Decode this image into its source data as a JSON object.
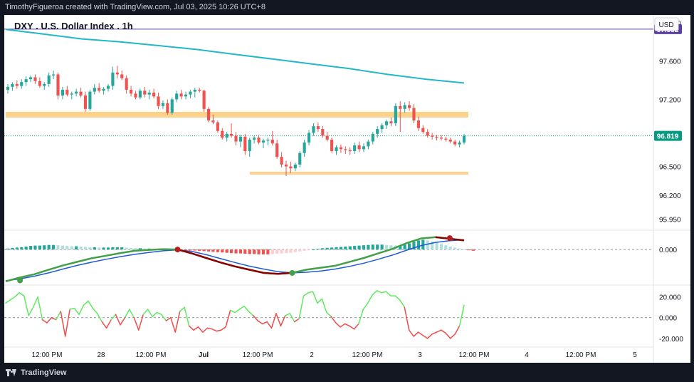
{
  "header": {
    "credit": "TimothyFigueroa created with TradingView.com, Jul 03, 2025 10:26 UTC+8"
  },
  "footer": {
    "brand": "TradingView"
  },
  "chart_data": {
    "type": "candlestick",
    "title": "DXY . U.S. Dollar Index . 1h",
    "currency_label": "USD",
    "price_axis": {
      "ylim": [
        95.85,
        98.08
      ],
      "ticks": [
        "98.000",
        "97.600",
        "97.200",
        "96.500",
        "96.200",
        "95.950"
      ],
      "tick_values": [
        98.0,
        97.6,
        97.2,
        96.5,
        96.2,
        95.95
      ]
    },
    "markers": [
      {
        "label": "97.932",
        "value": 97.932,
        "color": "#5b3fa3"
      },
      {
        "label": "96.819",
        "value": 96.819,
        "color": "#089981"
      }
    ],
    "x_axis": {
      "ticks": [
        "12:00 PM",
        "28",
        "12:00 PM",
        "Jul",
        "12:00 PM",
        "2",
        "12:00 PM",
        "3",
        "12:00 PM",
        "4",
        "12:00 PM",
        "5"
      ],
      "bold_ticks": [
        "Jul"
      ]
    },
    "moving_average": {
      "color": "#22b8c9",
      "values": [
        97.93,
        97.88,
        97.83,
        97.8,
        97.76,
        97.72,
        97.67,
        97.62,
        97.57,
        97.52,
        97.46,
        97.41,
        97.37
      ]
    },
    "zones": [
      {
        "low": 97.01,
        "high": 97.07,
        "from_index": 0,
        "to_index": 110,
        "color": "#fcd28c"
      },
      {
        "low": 96.415,
        "high": 96.445,
        "from_index": 53,
        "to_index": 110,
        "color": "#fcd28c"
      }
    ],
    "candle_colors": {
      "up": "#26a69a",
      "down": "#ef5350"
    },
    "candles": [
      [
        97.3,
        97.36,
        97.26,
        97.33
      ],
      [
        97.33,
        97.38,
        97.29,
        97.36
      ],
      [
        97.36,
        97.4,
        97.31,
        97.34
      ],
      [
        97.34,
        97.41,
        97.31,
        97.38
      ],
      [
        97.38,
        97.44,
        97.34,
        97.41
      ],
      [
        97.41,
        97.45,
        97.38,
        97.43
      ],
      [
        97.43,
        97.46,
        97.36,
        97.39
      ],
      [
        97.39,
        97.43,
        97.32,
        97.34
      ],
      [
        97.34,
        97.38,
        97.3,
        97.36
      ],
      [
        97.36,
        97.48,
        97.33,
        97.45
      ],
      [
        97.45,
        97.5,
        97.41,
        97.46
      ],
      [
        97.46,
        97.48,
        97.2,
        97.24
      ],
      [
        97.24,
        97.33,
        97.2,
        97.3
      ],
      [
        97.3,
        97.34,
        97.23,
        97.25
      ],
      [
        97.25,
        97.28,
        97.2,
        97.26
      ],
      [
        97.26,
        97.31,
        97.23,
        97.28
      ],
      [
        97.28,
        97.32,
        97.22,
        97.24
      ],
      [
        97.24,
        97.28,
        97.07,
        97.1
      ],
      [
        97.1,
        97.3,
        97.08,
        97.28
      ],
      [
        97.28,
        97.36,
        97.25,
        97.32
      ],
      [
        97.32,
        97.37,
        97.27,
        97.29
      ],
      [
        97.29,
        97.33,
        97.25,
        97.31
      ],
      [
        97.31,
        97.36,
        97.28,
        97.34
      ],
      [
        97.34,
        97.54,
        97.3,
        97.48
      ],
      [
        97.48,
        97.55,
        97.42,
        97.46
      ],
      [
        97.46,
        97.5,
        97.4,
        97.42
      ],
      [
        97.42,
        97.45,
        97.26,
        97.3
      ],
      [
        97.3,
        97.34,
        97.23,
        97.26
      ],
      [
        97.26,
        97.29,
        97.2,
        97.22
      ],
      [
        97.22,
        97.31,
        97.2,
        97.29
      ],
      [
        97.29,
        97.33,
        97.22,
        97.25
      ],
      [
        97.25,
        97.3,
        97.2,
        97.27
      ],
      [
        97.27,
        97.31,
        97.21,
        97.23
      ],
      [
        97.23,
        97.27,
        97.1,
        97.13
      ],
      [
        97.13,
        97.19,
        97.1,
        97.16
      ],
      [
        97.16,
        97.2,
        97.04,
        97.06
      ],
      [
        97.06,
        97.22,
        97.04,
        97.2
      ],
      [
        97.2,
        97.29,
        97.17,
        97.26
      ],
      [
        97.26,
        97.3,
        97.2,
        97.23
      ],
      [
        97.23,
        97.28,
        97.2,
        97.25
      ],
      [
        97.25,
        97.3,
        97.21,
        97.28
      ],
      [
        97.28,
        97.32,
        97.22,
        97.3
      ],
      [
        97.3,
        97.32,
        97.27,
        97.29
      ],
      [
        97.29,
        97.3,
        97.07,
        97.1
      ],
      [
        97.1,
        97.12,
        96.96,
        96.98
      ],
      [
        96.98,
        97.04,
        96.94,
        96.96
      ],
      [
        96.96,
        96.98,
        96.85,
        96.87
      ],
      [
        96.87,
        96.9,
        96.78,
        96.8
      ],
      [
        96.8,
        96.86,
        96.76,
        96.84
      ],
      [
        96.84,
        96.95,
        96.8,
        96.82
      ],
      [
        96.82,
        96.86,
        96.72,
        96.76
      ],
      [
        96.76,
        96.83,
        96.7,
        96.81
      ],
      [
        96.81,
        96.84,
        96.62,
        96.66
      ],
      [
        96.66,
        96.8,
        96.6,
        96.78
      ],
      [
        96.78,
        96.82,
        96.74,
        96.8
      ],
      [
        96.8,
        96.83,
        96.73,
        96.75
      ],
      [
        96.75,
        96.79,
        96.69,
        96.77
      ],
      [
        96.77,
        96.8,
        96.72,
        96.78
      ],
      [
        96.78,
        96.87,
        96.72,
        96.74
      ],
      [
        96.74,
        96.78,
        96.58,
        96.6
      ],
      [
        96.6,
        96.65,
        96.49,
        96.52
      ],
      [
        96.52,
        96.56,
        96.4,
        96.5
      ],
      [
        96.5,
        96.55,
        96.43,
        96.48
      ],
      [
        96.48,
        96.54,
        96.45,
        96.52
      ],
      [
        96.52,
        96.66,
        96.49,
        96.64
      ],
      [
        96.64,
        96.78,
        96.6,
        96.75
      ],
      [
        96.75,
        96.88,
        96.72,
        96.85
      ],
      [
        96.85,
        96.95,
        96.82,
        96.92
      ],
      [
        96.92,
        96.96,
        96.86,
        96.89
      ],
      [
        96.89,
        96.92,
        96.8,
        96.82
      ],
      [
        96.82,
        96.86,
        96.76,
        96.78
      ],
      [
        96.78,
        96.8,
        96.64,
        96.66
      ],
      [
        96.66,
        96.72,
        96.62,
        96.7
      ],
      [
        96.7,
        96.73,
        96.64,
        96.68
      ],
      [
        96.68,
        96.71,
        96.63,
        96.67
      ],
      [
        96.67,
        96.7,
        96.62,
        96.66
      ],
      [
        96.66,
        96.75,
        96.63,
        96.72
      ],
      [
        96.72,
        96.76,
        96.65,
        96.68
      ],
      [
        96.68,
        96.74,
        96.65,
        96.71
      ],
      [
        96.71,
        96.78,
        96.68,
        96.76
      ],
      [
        96.76,
        96.86,
        96.73,
        96.84
      ],
      [
        96.84,
        96.92,
        96.8,
        96.89
      ],
      [
        96.89,
        96.95,
        96.85,
        96.93
      ],
      [
        96.93,
        96.99,
        96.89,
        96.97
      ],
      [
        96.97,
        97.01,
        96.92,
        96.95
      ],
      [
        96.95,
        97.16,
        96.92,
        97.13
      ],
      [
        97.13,
        97.18,
        96.86,
        97.1
      ],
      [
        97.1,
        97.17,
        97.06,
        97.14
      ],
      [
        97.14,
        97.18,
        97.08,
        97.11
      ],
      [
        97.11,
        97.15,
        96.95,
        96.98
      ],
      [
        96.98,
        97.02,
        96.87,
        96.9
      ],
      [
        96.9,
        96.93,
        96.84,
        96.86
      ],
      [
        96.86,
        96.89,
        96.8,
        96.82
      ],
      [
        96.82,
        96.85,
        96.78,
        96.81
      ],
      [
        96.81,
        96.83,
        96.77,
        96.8
      ],
      [
        96.8,
        96.83,
        96.77,
        96.79
      ],
      [
        96.79,
        96.81,
        96.76,
        96.78
      ],
      [
        96.78,
        96.8,
        96.74,
        96.76
      ],
      [
        96.76,
        96.78,
        96.71,
        96.73
      ],
      [
        96.73,
        96.77,
        96.7,
        96.75
      ],
      [
        96.75,
        96.84,
        96.73,
        96.82
      ]
    ],
    "oscillator": {
      "zero_label": "0.000",
      "ylim": [
        -1.05,
        0.55
      ],
      "histogram_colors": {
        "up_strong": "#26a69a",
        "up_weak": "#b2dfdb",
        "down_strong": "#ef5350",
        "down_weak": "#ffcdd2"
      },
      "histogram": [
        0.03,
        0.05,
        0.06,
        0.07,
        0.09,
        0.11,
        0.12,
        0.12,
        0.13,
        0.14,
        0.14,
        0.13,
        0.12,
        0.11,
        0.1,
        0.1,
        0.09,
        0.08,
        0.07,
        0.07,
        0.06,
        0.06,
        0.06,
        0.07,
        0.07,
        0.07,
        0.06,
        0.05,
        0.04,
        0.04,
        0.03,
        0.03,
        0.02,
        0.01,
        0.0,
        -0.01,
        -0.01,
        -0.02,
        -0.02,
        -0.03,
        -0.03,
        -0.03,
        -0.04,
        -0.05,
        -0.06,
        -0.07,
        -0.08,
        -0.09,
        -0.1,
        -0.11,
        -0.12,
        -0.12,
        -0.13,
        -0.14,
        -0.14,
        -0.15,
        -0.15,
        -0.15,
        -0.14,
        -0.13,
        -0.12,
        -0.11,
        -0.1,
        -0.08,
        -0.06,
        -0.04,
        -0.02,
        0.0,
        0.02,
        0.04,
        0.05,
        0.06,
        0.07,
        0.08,
        0.09,
        0.1,
        0.11,
        0.12,
        0.13,
        0.14,
        0.15,
        0.15,
        0.15,
        0.14,
        0.13,
        0.12,
        0.13,
        0.15,
        0.19,
        0.24,
        0.28,
        0.3,
        0.28,
        0.25,
        0.21,
        0.17,
        0.13,
        0.09,
        0.06,
        0.03,
        0.01,
        -0.02,
        -0.04
      ],
      "fast_line": {
        "color": "#43a047",
        "values": [
          -0.98,
          -0.86,
          -0.76,
          -0.62,
          -0.49,
          -0.38,
          -0.27,
          -0.19,
          -0.11,
          -0.04,
          -0.01,
          0.01,
          0.0,
          -0.12,
          -0.26,
          -0.4,
          -0.52,
          -0.62,
          -0.72,
          -0.75,
          -0.72,
          -0.62,
          -0.56,
          -0.5,
          -0.38,
          -0.26,
          -0.12,
          0.02,
          0.2,
          0.34,
          0.38,
          0.33,
          0.28
        ]
      },
      "slow_line": {
        "color": "#1e5bd6",
        "values": [
          -0.96,
          -0.9,
          -0.82,
          -0.72,
          -0.6,
          -0.49,
          -0.39,
          -0.3,
          -0.22,
          -0.15,
          -0.09,
          -0.04,
          -0.01,
          -0.06,
          -0.16,
          -0.28,
          -0.4,
          -0.51,
          -0.6,
          -0.68,
          -0.72,
          -0.7,
          -0.66,
          -0.6,
          -0.52,
          -0.42,
          -0.3,
          -0.17,
          -0.02,
          0.12,
          0.22,
          0.27,
          0.3
        ]
      },
      "bear_segments": [
        [
          12,
          20
        ],
        [
          30,
          32
        ]
      ],
      "bear_color": "#8b0000",
      "cross_points": [
        {
          "index": 1,
          "value": -0.95,
          "color": "#43a047"
        },
        {
          "index": 12,
          "value": 0.0,
          "color": "#b71c1c"
        },
        {
          "index": 20,
          "value": -0.72,
          "color": "#43a047"
        },
        {
          "index": 31,
          "value": 0.35,
          "color": "#b71c1c"
        }
      ]
    },
    "rsi_panel": {
      "ticks": [
        "20.000",
        "0.000",
        "-20.000"
      ],
      "tick_values": [
        20,
        0,
        -20
      ],
      "ylim": [
        -27,
        30
      ],
      "colors": {
        "positive": "#5eea5e",
        "negative": "#ef4b4b"
      },
      "values": [
        14,
        17,
        20,
        24,
        21,
        2,
        10,
        20,
        -2,
        -5,
        0,
        -2,
        6,
        -18,
        8,
        9,
        3,
        12,
        16,
        9,
        4,
        -4,
        -10,
        -2,
        3,
        -7,
        0,
        8,
        0,
        -12,
        3,
        8,
        1,
        5,
        3,
        -3,
        0,
        -14,
        6,
        10,
        -8,
        -12,
        -9,
        -14,
        -10,
        -11,
        -13,
        -12,
        -9,
        7,
        5,
        8,
        11,
        6,
        2,
        -3,
        -6,
        -4,
        -10,
        4,
        -8,
        2,
        4,
        -4,
        -1,
        21,
        24,
        25,
        14,
        18,
        5,
        1,
        -5,
        -9,
        -6,
        -8,
        -11,
        -6,
        8,
        14,
        22,
        26,
        24,
        25,
        21,
        21,
        17,
        10,
        -12,
        -18,
        -14,
        -17,
        -20,
        -16,
        -14,
        -12,
        -15,
        -20,
        -16,
        -8,
        12
      ]
    }
  }
}
